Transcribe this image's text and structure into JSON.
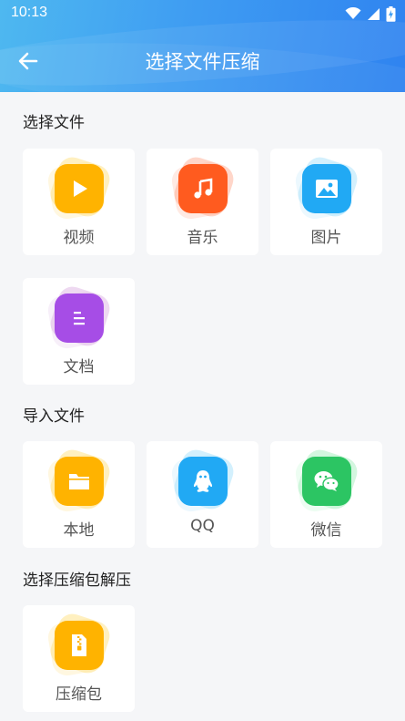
{
  "status_bar": {
    "time": "10:13"
  },
  "header": {
    "title": "选择文件压缩"
  },
  "sections": {
    "select_files": {
      "title": "选择文件",
      "items": [
        {
          "label": "视频",
          "icon": "play-icon",
          "color": "#ffb300"
        },
        {
          "label": "音乐",
          "icon": "music-note-icon",
          "color": "#ff5b1f"
        },
        {
          "label": "图片",
          "icon": "image-icon",
          "color": "#21a9f4"
        },
        {
          "label": "文档",
          "icon": "document-icon",
          "color": "#a64de6"
        }
      ]
    },
    "import_files": {
      "title": "导入文件",
      "items": [
        {
          "label": "本地",
          "icon": "folder-icon",
          "color": "#ffb300"
        },
        {
          "label": "QQ",
          "icon": "qq-icon",
          "color": "#21a9f4"
        },
        {
          "label": "微信",
          "icon": "wechat-icon",
          "color": "#2cc563"
        }
      ]
    },
    "extract": {
      "title": "选择压缩包解压",
      "items": [
        {
          "label": "压缩包",
          "icon": "archive-icon",
          "color": "#ffb300"
        }
      ]
    }
  }
}
